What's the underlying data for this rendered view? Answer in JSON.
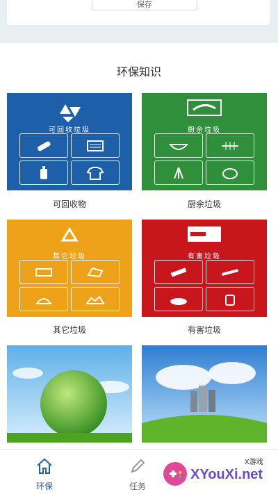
{
  "top_card": {
    "button_label": "保存"
  },
  "section_title": "环保知识",
  "tiles": [
    {
      "heading": "可回收垃圾",
      "caption": "可回收物",
      "color": "#1e5faa"
    },
    {
      "heading": "厨余垃圾",
      "caption": "厨余垃圾",
      "color": "#2f8f3a"
    },
    {
      "heading": "其它垃圾",
      "caption": "其它垃圾",
      "color": "#eea21a"
    },
    {
      "heading": "有害垃圾",
      "caption": "有害垃圾",
      "color": "#c8161d"
    }
  ],
  "tabbar": {
    "tabs": [
      {
        "label": "环保",
        "icon": "house-icon",
        "active": true
      },
      {
        "label": "任务",
        "icon": "pencil-icon",
        "active": false
      }
    ],
    "active_color": "#2a5f9e",
    "inactive_color": "#999999"
  },
  "watermark": {
    "text": "XYouXi.net",
    "small": "X游戏"
  }
}
